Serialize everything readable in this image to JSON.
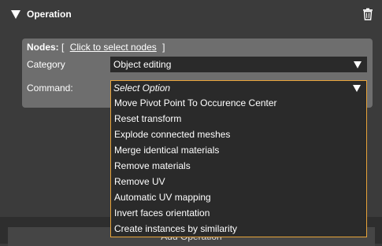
{
  "header": {
    "title": "Operation"
  },
  "nodes": {
    "label": "Nodes:",
    "open_bracket": "[",
    "link": "Click to select nodes",
    "close_bracket": "]"
  },
  "category": {
    "label": "Category",
    "value": "Object editing"
  },
  "command": {
    "label": "Command:",
    "value": "Select Option",
    "options": [
      "Move Pivot Point To Occurence Center",
      "Reset transform",
      "Explode connected meshes",
      "Merge identical materials",
      "Remove materials",
      "Remove UV",
      "Automatic UV mapping",
      "Invert faces orientation",
      "Create instances by similarity"
    ]
  },
  "footer": {
    "add_label": "Add Operation"
  },
  "colors": {
    "accent": "#e8a43a",
    "background": "#3b3b3b",
    "card": "#6e6e6e",
    "field": "#2a2a2a"
  },
  "icons": {
    "collapse": "triangle-down-icon",
    "delete": "trash-icon",
    "dropdown": "chevron-down-icon"
  }
}
